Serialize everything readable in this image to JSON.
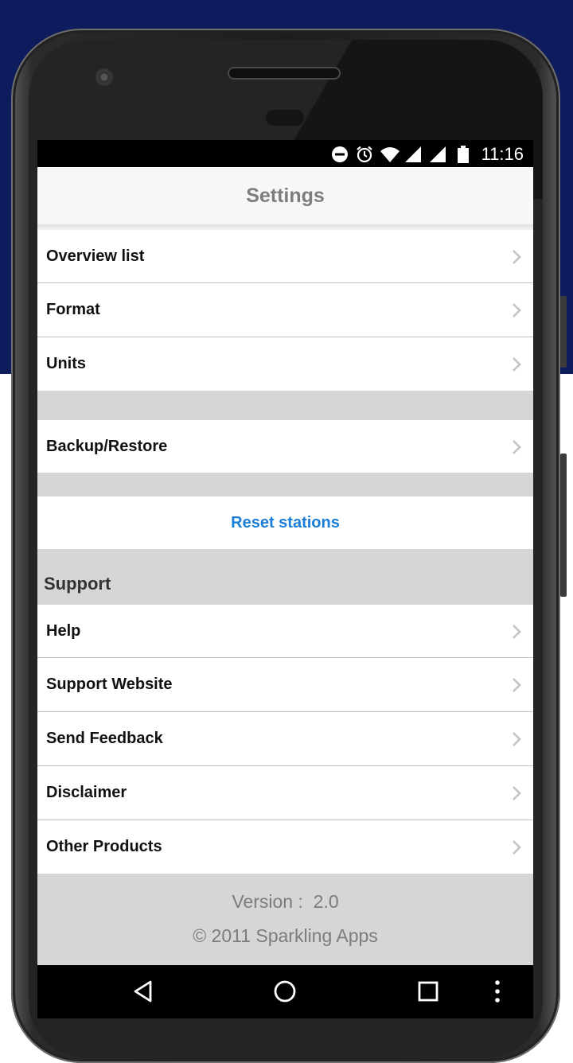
{
  "status_bar": {
    "time": "11:16",
    "icons": [
      "do-not-disturb-icon",
      "alarm-icon",
      "wifi-icon",
      "signal-icon",
      "signal-icon",
      "battery-icon"
    ]
  },
  "header": {
    "title": "Settings"
  },
  "settings_items": [
    {
      "label": "Overview list"
    },
    {
      "label": "Format"
    },
    {
      "label": "Units"
    }
  ],
  "backup_item": {
    "label": "Backup/Restore"
  },
  "reset_action": {
    "label": "Reset stations",
    "color": "#1a7ed6"
  },
  "support": {
    "header": "Support",
    "items": [
      {
        "label": "Help"
      },
      {
        "label": "Support Website"
      },
      {
        "label": "Send Feedback"
      },
      {
        "label": "Disclaimer"
      },
      {
        "label": "Other Products"
      }
    ]
  },
  "footer": {
    "version": "Version :  2.0",
    "copyright": "© 2011 Sparkling Apps"
  },
  "nav_bar": {
    "buttons": [
      "back-icon",
      "home-icon",
      "recents-icon",
      "overflow-menu-icon"
    ]
  },
  "colors": {
    "background_top": "#0e1c5e",
    "link": "#1a7ed6",
    "section_gap": "#d6d6d6"
  }
}
